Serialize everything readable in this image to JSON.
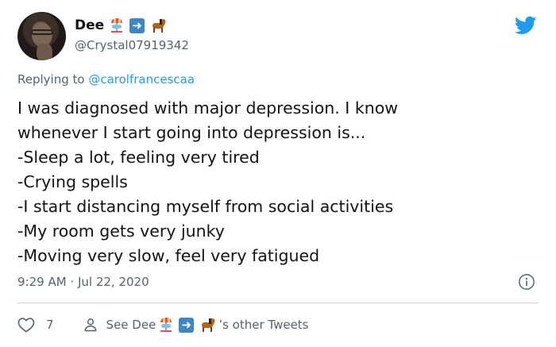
{
  "author": {
    "name": "Dee",
    "handle": "@Crystal07919342",
    "name_emojis": [
      "carousel-horse-icon",
      "right-arrow-icon",
      "horse-icon"
    ]
  },
  "reply": {
    "prefix": "Replying to ",
    "mention": "@carolfrancescaa"
  },
  "tweet_lines": [
    "I was diagnosed with major depression. I know",
    "whenever I start going into depression is...",
    "-Sleep a lot, feeling very tired",
    "-Crying spells",
    "-I start distancing myself from social activities",
    "-My room gets very junky",
    "-Moving very slow, feel very fatigued"
  ],
  "timestamp": "9:29 AM · Jul 22, 2020",
  "footer": {
    "like_count": "7",
    "see_prefix": "See Dee",
    "see_suffix": "’s other Tweets"
  },
  "colors": {
    "twitter_blue": "#1d9bf0",
    "secondary_text": "#536471",
    "divider": "#cfd9de"
  }
}
